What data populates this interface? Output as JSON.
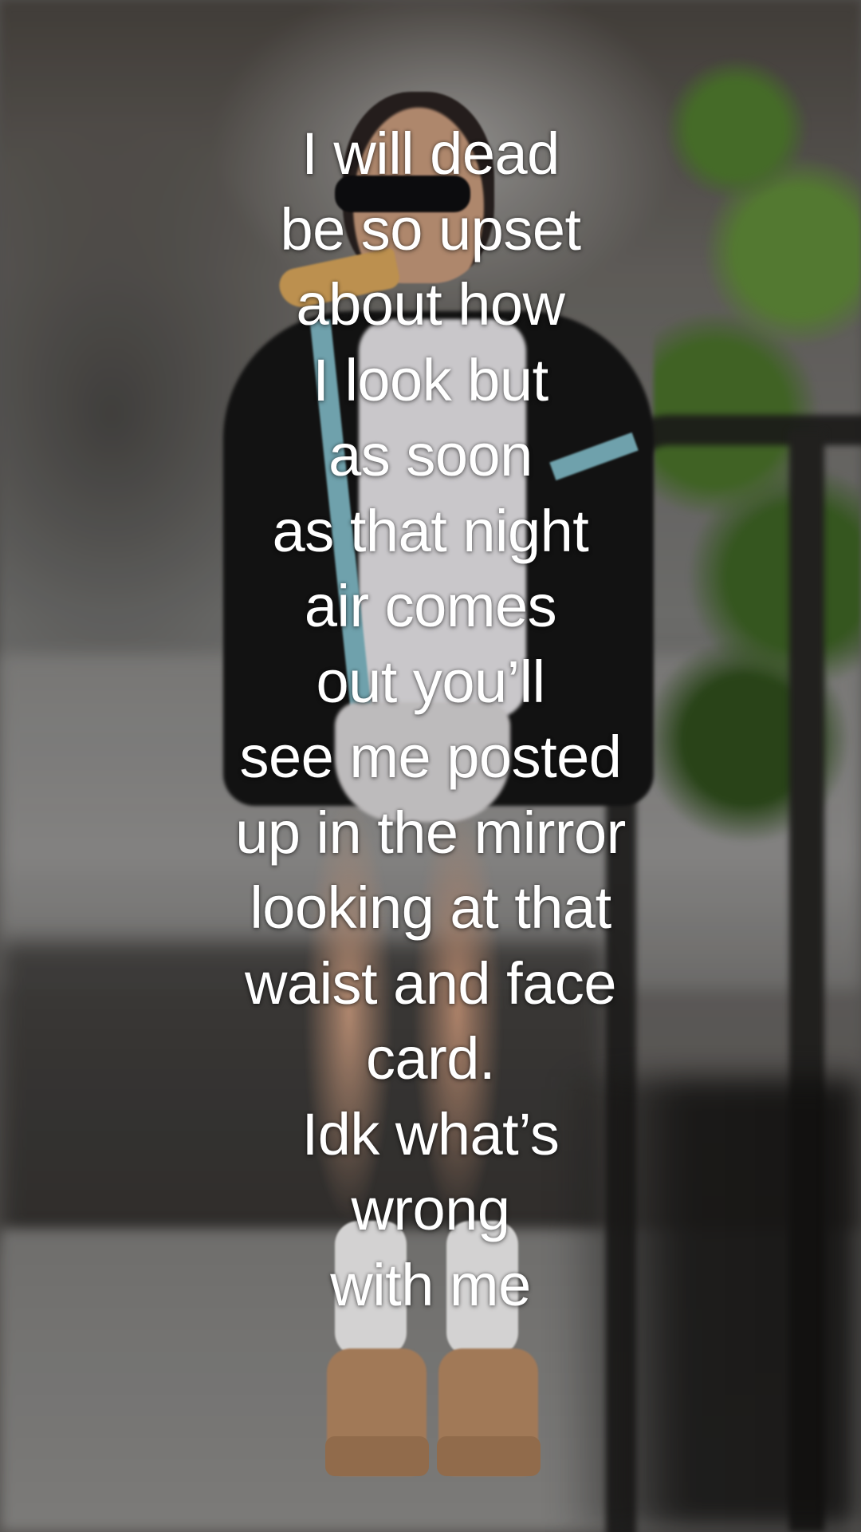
{
  "caption": {
    "lines": [
      "I will dead",
      "be so upset",
      "about how",
      "I look but",
      "as soon",
      "as that night",
      "air comes",
      "out you’ll",
      "see me posted",
      "up in the mirror",
      "looking at that",
      "waist and face",
      "card.",
      "Idk what’s",
      "wrong",
      "with me"
    ],
    "color": "#ffffff"
  }
}
